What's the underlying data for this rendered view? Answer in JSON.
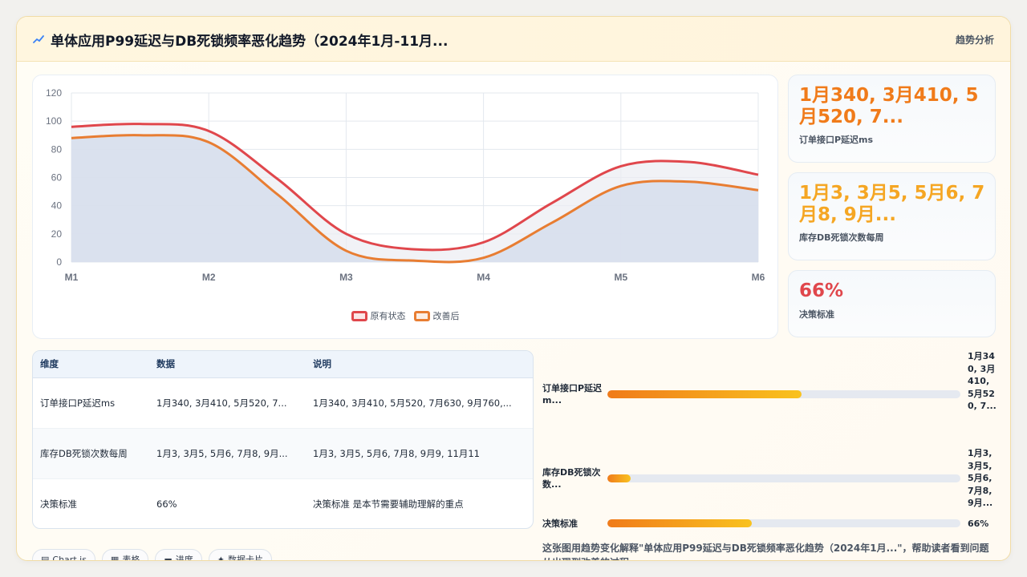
{
  "header": {
    "title": "单体应用P99延迟与DB死锁频率恶化趋势（2024年1月-11月...",
    "tag": "趋势分析",
    "icon": "trend-icon"
  },
  "chart_data": {
    "type": "area",
    "categories": [
      "M1",
      "M2",
      "M3",
      "M4",
      "M5",
      "M6"
    ],
    "ylim": [
      0,
      120
    ],
    "yticks": [
      0,
      20,
      40,
      60,
      80,
      100,
      120
    ],
    "series": [
      {
        "name": "原有状态",
        "color": "#e0474c",
        "x": [
          1,
          1.5,
          2,
          2.5,
          3,
          3.5,
          4,
          4.5,
          5,
          5.5,
          6
        ],
        "values": [
          96,
          98,
          93,
          59,
          20,
          9,
          14,
          42,
          68,
          71,
          62
        ]
      },
      {
        "name": "改善后",
        "color": "#e87d32",
        "x": [
          1,
          1.5,
          2,
          2.5,
          3,
          3.5,
          4,
          4.5,
          5,
          5.5,
          6
        ],
        "values": [
          88,
          90,
          85,
          48,
          8,
          1,
          3,
          28,
          54,
          57,
          51
        ]
      }
    ],
    "legend_position": "bottom",
    "grid": true
  },
  "kpis": [
    {
      "value": "1月340, 3月410, 5月520, 7...",
      "label": "订单接口P延迟ms",
      "color": "#f07b1a"
    },
    {
      "value": "1月3, 3月5, 5月6, 7月8, 9月...",
      "label": "库存DB死锁次数每周",
      "color": "#f5a623"
    },
    {
      "value": "66%",
      "label": "决策标准",
      "color": "#e0474c"
    }
  ],
  "table": {
    "headers": [
      "维度",
      "数据",
      "说明"
    ],
    "rows": [
      [
        "订单接口P延迟ms",
        "1月340, 3月410, 5月520, 7...",
        "1月340, 3月410, 5月520, 7月630, 9月760,..."
      ],
      [
        "库存DB死锁次数每周",
        "1月3, 3月5, 5月6, 7月8, 9月...",
        "1月3, 3月5, 5月6, 7月8, 9月9, 11月11"
      ],
      [
        "决策标准",
        "66%",
        "决策标准 是本节需要辅助理解的重点"
      ]
    ]
  },
  "progress": [
    {
      "label": "订单接口P延迟m...",
      "fraction": 0.55,
      "value": "1月340, 3月410, 5月520, 7..."
    },
    {
      "label": "库存DB死锁次数...",
      "fraction": 0.065,
      "value": "1月3, 3月5, 5月6, 7月8, 9月..."
    },
    {
      "label": "决策标准",
      "fraction": 0.41,
      "value": "66%"
    }
  ],
  "summary": "这张图用趋势变化解释\"单体应用P99延迟与DB死锁频率恶化趋势（2024年1月...\"，帮助读者看到问题从出现到改善的过程。",
  "tabs": [
    {
      "label": "Chart.js",
      "icon": "chart-icon"
    },
    {
      "label": "表格",
      "icon": "table-icon"
    },
    {
      "label": "进度",
      "icon": "progress-icon"
    },
    {
      "label": "数据卡片",
      "icon": "sparkle-icon"
    }
  ]
}
